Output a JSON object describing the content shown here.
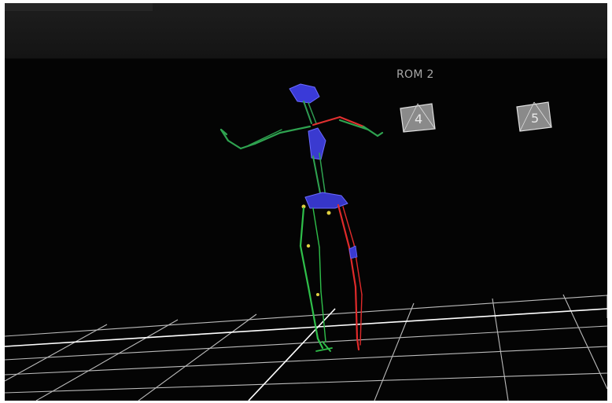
{
  "viewport": {
    "take_name": "ROM 2",
    "cameras": [
      {
        "id": "camera-4",
        "label": "4"
      },
      {
        "id": "camera-5",
        "label": "5"
      }
    ],
    "icons": [
      "camera-icon",
      "skeleton-icon",
      "grid-icon"
    ]
  },
  "colors": {
    "background": "#040404",
    "toolbar": "#1a1a1a",
    "grid": "#d0d0d0",
    "skeleton_left": "#2fbf4a",
    "skeleton_right": "#e03030",
    "joint_blue": "#4a4adc",
    "spine_green": "#3a9a5a"
  }
}
